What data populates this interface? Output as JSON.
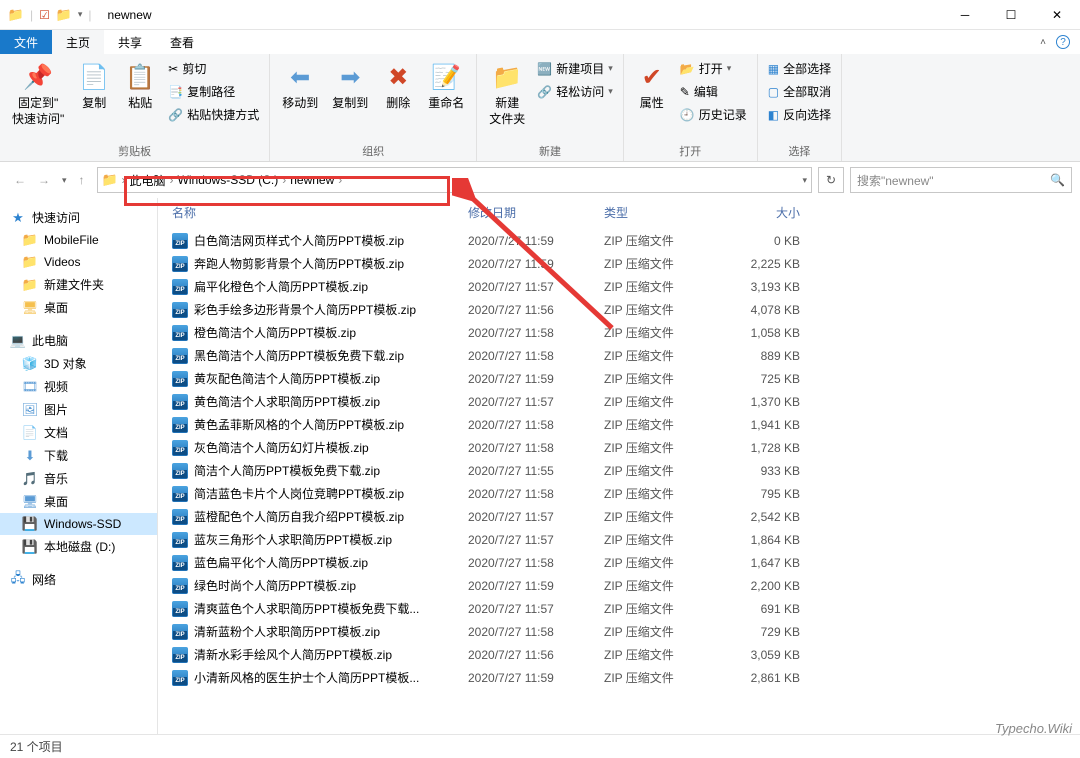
{
  "window": {
    "title": "newnew"
  },
  "tabs": {
    "file": "文件",
    "home": "主页",
    "share": "共享",
    "view": "查看"
  },
  "ribbon": {
    "clipboard": {
      "label": "剪贴板",
      "pin": "固定到\"\n快速访问\"",
      "copy": "复制",
      "paste": "粘贴",
      "cut": "剪切",
      "copypath": "复制路径",
      "pasteshortcut": "粘贴快捷方式"
    },
    "organize": {
      "label": "组织",
      "moveto": "移动到",
      "copyto": "复制到",
      "delete": "删除",
      "rename": "重命名"
    },
    "new": {
      "label": "新建",
      "newfolder": "新建\n文件夹",
      "newitem": "新建项目",
      "easyaccess": "轻松访问"
    },
    "open": {
      "label": "打开",
      "properties": "属性",
      "openitem": "打开",
      "edit": "编辑",
      "history": "历史记录"
    },
    "select": {
      "label": "选择",
      "selectall": "全部选择",
      "selectnone": "全部取消",
      "invert": "反向选择"
    }
  },
  "breadcrumb": {
    "thispc": "此电脑",
    "drive": "Windows-SSD (C:)",
    "folder": "newnew"
  },
  "search": {
    "placeholder": "搜索\"newnew\""
  },
  "sidebar": {
    "quickaccess": "快速访问",
    "items1": [
      "MobileFile",
      "Videos",
      "新建文件夹",
      "桌面"
    ],
    "thispc": "此电脑",
    "items2": [
      "3D 对象",
      "视频",
      "图片",
      "文档",
      "下载",
      "音乐",
      "桌面",
      "Windows-SSD",
      "本地磁盘 (D:)"
    ],
    "network": "网络"
  },
  "columns": {
    "name": "名称",
    "date": "修改日期",
    "type": "类型",
    "size": "大小"
  },
  "filetype": "ZIP 压缩文件",
  "files": [
    {
      "name": "白色简洁网页样式个人简历PPT模板.zip",
      "date": "2020/7/27 11:59",
      "size": "0 KB"
    },
    {
      "name": "奔跑人物剪影背景个人简历PPT模板.zip",
      "date": "2020/7/27 11:59",
      "size": "2,225 KB"
    },
    {
      "name": "扁平化橙色个人简历PPT模板.zip",
      "date": "2020/7/27 11:57",
      "size": "3,193 KB"
    },
    {
      "name": "彩色手绘多边形背景个人简历PPT模板.zip",
      "date": "2020/7/27 11:56",
      "size": "4,078 KB"
    },
    {
      "name": "橙色简洁个人简历PPT模板.zip",
      "date": "2020/7/27 11:58",
      "size": "1,058 KB"
    },
    {
      "name": "黑色简洁个人简历PPT模板免费下载.zip",
      "date": "2020/7/27 11:58",
      "size": "889 KB"
    },
    {
      "name": "黄灰配色简洁个人简历PPT模板.zip",
      "date": "2020/7/27 11:59",
      "size": "725 KB"
    },
    {
      "name": "黄色简洁个人求职简历PPT模板.zip",
      "date": "2020/7/27 11:57",
      "size": "1,370 KB"
    },
    {
      "name": "黄色孟菲斯风格的个人简历PPT模板.zip",
      "date": "2020/7/27 11:58",
      "size": "1,941 KB"
    },
    {
      "name": "灰色简洁个人简历幻灯片模板.zip",
      "date": "2020/7/27 11:58",
      "size": "1,728 KB"
    },
    {
      "name": "简洁个人简历PPT模板免费下载.zip",
      "date": "2020/7/27 11:55",
      "size": "933 KB"
    },
    {
      "name": "简洁蓝色卡片个人岗位竞聘PPT模板.zip",
      "date": "2020/7/27 11:58",
      "size": "795 KB"
    },
    {
      "name": "蓝橙配色个人简历自我介绍PPT模板.zip",
      "date": "2020/7/27 11:57",
      "size": "2,542 KB"
    },
    {
      "name": "蓝灰三角形个人求职简历PPT模板.zip",
      "date": "2020/7/27 11:57",
      "size": "1,864 KB"
    },
    {
      "name": "蓝色扁平化个人简历PPT模板.zip",
      "date": "2020/7/27 11:58",
      "size": "1,647 KB"
    },
    {
      "name": "绿色时尚个人简历PPT模板.zip",
      "date": "2020/7/27 11:59",
      "size": "2,200 KB"
    },
    {
      "name": "清爽蓝色个人求职简历PPT模板免费下载...",
      "date": "2020/7/27 11:57",
      "size": "691 KB"
    },
    {
      "name": "清新蓝粉个人求职简历PPT模板.zip",
      "date": "2020/7/27 11:58",
      "size": "729 KB"
    },
    {
      "name": "清新水彩手绘风个人简历PPT模板.zip",
      "date": "2020/7/27 11:56",
      "size": "3,059 KB"
    },
    {
      "name": "小清新风格的医生护士个人简历PPT模板...",
      "date": "2020/7/27 11:59",
      "size": "2,861 KB"
    }
  ],
  "status": "21 个项目",
  "watermark": "Typecho.Wiki"
}
